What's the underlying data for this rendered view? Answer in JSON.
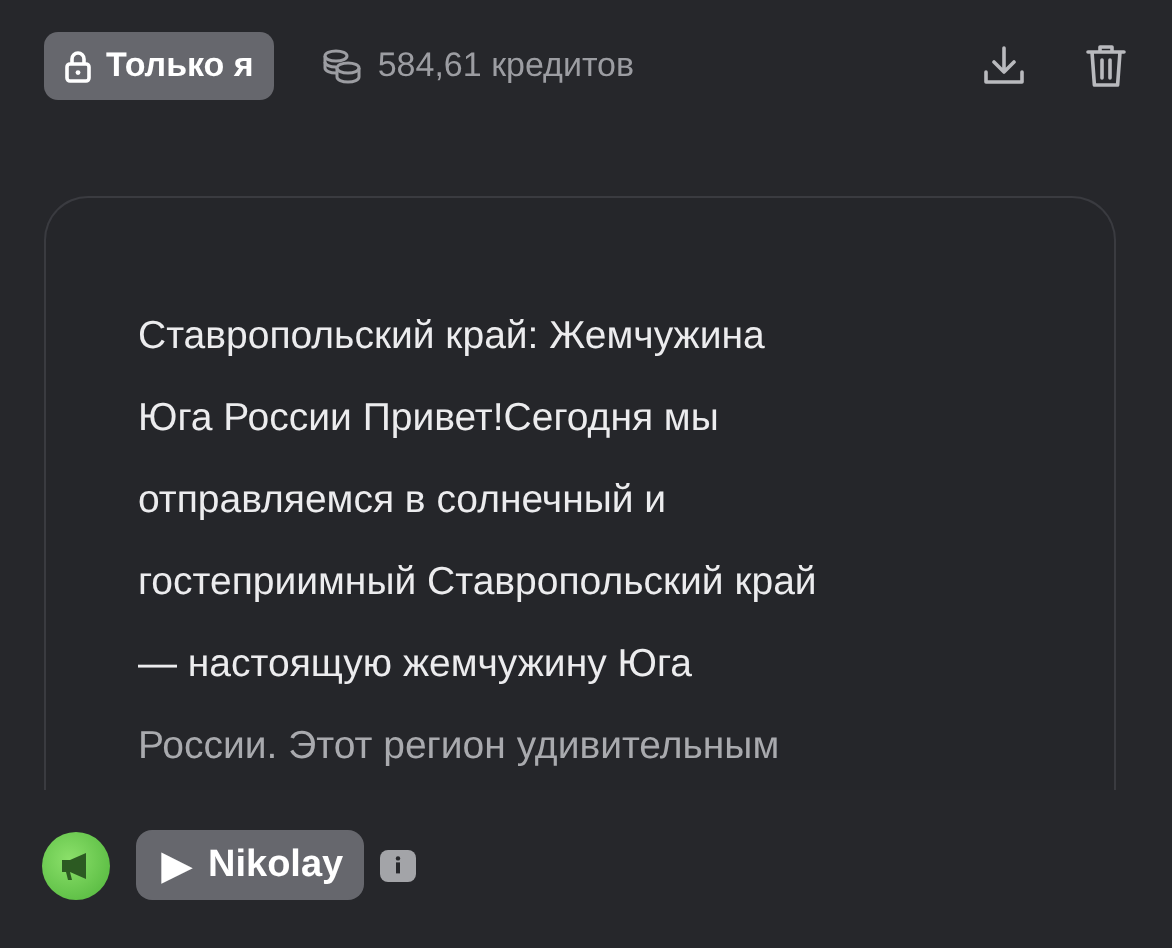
{
  "header": {
    "visibility": "Только я",
    "credits": "584,61 кредитов"
  },
  "story": {
    "lines": [
      "Ставропольский край: Жемчужина",
      "Юга России Привет!Сегодня мы",
      "отправляемся в солнечный и",
      "гостеприимный Ставропольский край",
      "— настоящую жемчужину Юга",
      "России. Этот регион удивительным"
    ]
  },
  "voice": {
    "play_symbol": "▶",
    "name": "Nikolay"
  }
}
